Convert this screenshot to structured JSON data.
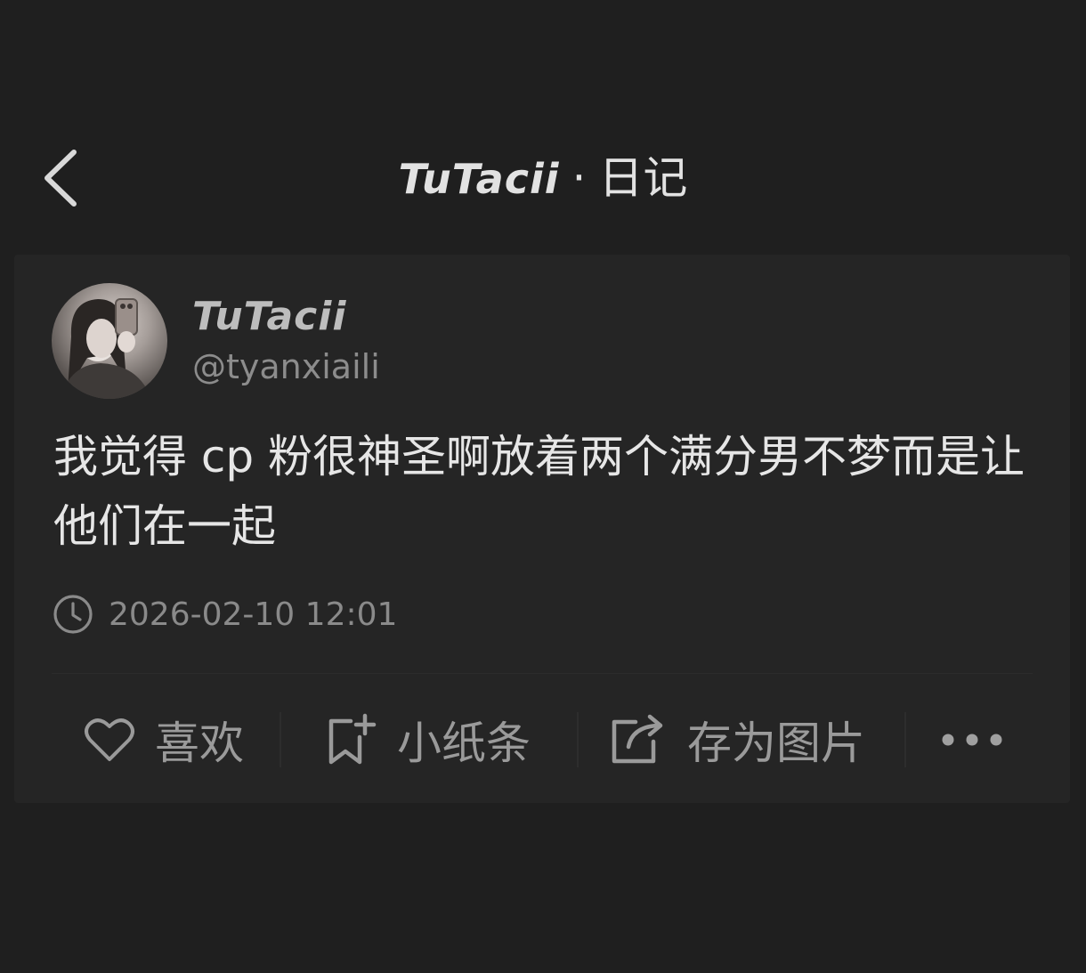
{
  "header": {
    "title_brand": "TuTacii",
    "title_separator": "·",
    "title_section": "日记"
  },
  "post": {
    "author_name": "TuTacii",
    "author_handle": "@tyanxiaili",
    "content": "我觉得 cp 粉很神圣啊放着两个满分男不梦而是让他们在一起",
    "timestamp": "2026-02-10 12:01"
  },
  "actions": {
    "like_label": "喜欢",
    "note_label": "小纸条",
    "save_image_label": "存为图片"
  },
  "icons": {
    "back": "chevron-left-icon",
    "clock": "clock-icon",
    "like": "heart-icon",
    "note": "bookmark-add-icon",
    "save_image": "share-export-icon",
    "more": "more-dots-icon"
  },
  "colors": {
    "background": "#1f1f1f",
    "card": "#252525",
    "primary_text": "#e6e6e6",
    "secondary_text": "#8a8a8a"
  }
}
